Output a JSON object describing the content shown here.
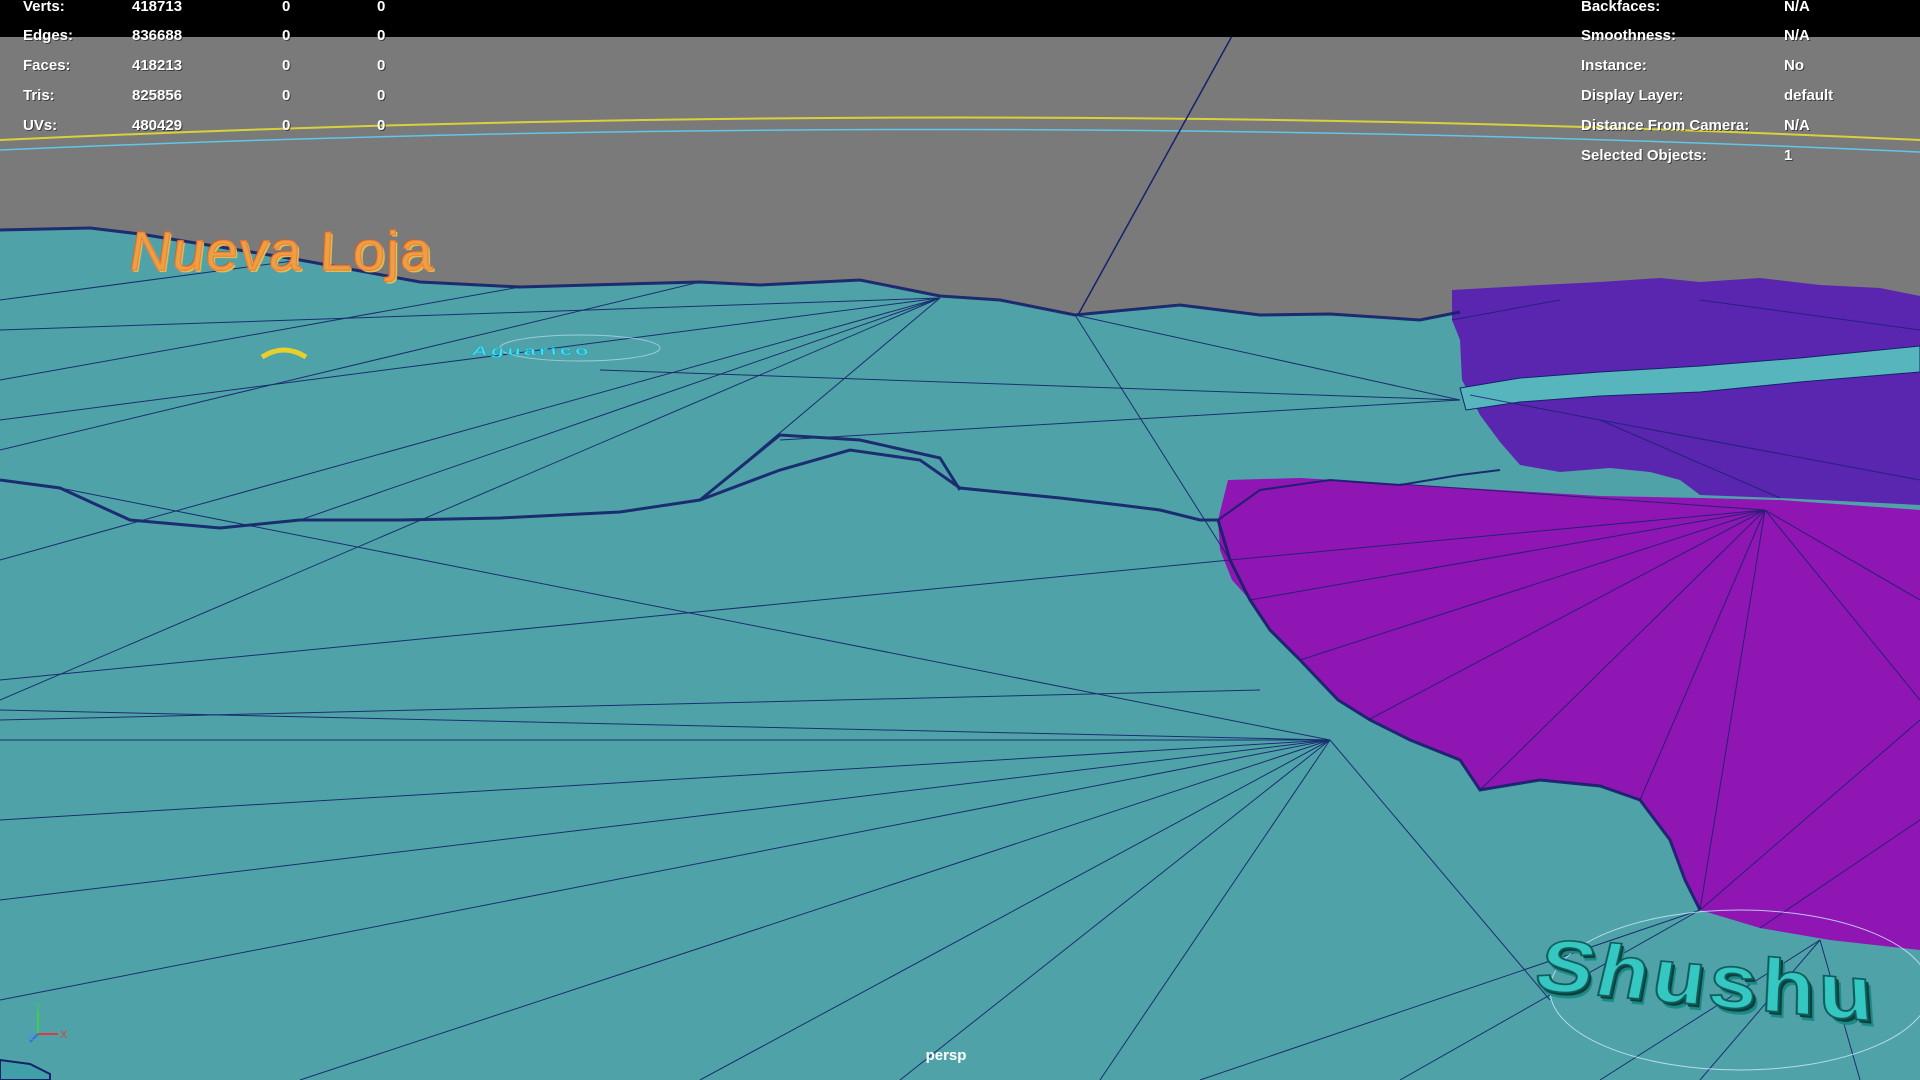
{
  "viewport": {
    "camera": "persp"
  },
  "hud_left": {
    "rows": [
      {
        "label": "Verts:",
        "total": "418713",
        "selected": "0",
        "extra": "0"
      },
      {
        "label": "Edges:",
        "total": "836688",
        "selected": "0",
        "extra": "0"
      },
      {
        "label": "Faces:",
        "total": "418213",
        "selected": "0",
        "extra": "0"
      },
      {
        "label": "Tris:",
        "total": "825856",
        "selected": "0",
        "extra": "0"
      },
      {
        "label": "UVs:",
        "total": "480429",
        "selected": "0",
        "extra": "0"
      }
    ]
  },
  "hud_right": {
    "rows": [
      {
        "label": "Backfaces:",
        "value": "N/A"
      },
      {
        "label": "Smoothness:",
        "value": "N/A"
      },
      {
        "label": "Instance:",
        "value": "No"
      },
      {
        "label": "Display Layer:",
        "value": "default"
      },
      {
        "label": "Distance From Camera:",
        "value": "N/A"
      },
      {
        "label": "Selected Objects:",
        "value": "1"
      }
    ]
  },
  "scene": {
    "city_labels": {
      "nueva_loja": "Nueva Loja",
      "shushufindi": "Shushu",
      "small_label": "Aguarico"
    },
    "colors": {
      "background": "#7a7a7a",
      "terrain_teal": "#4fa3a8",
      "wire": "#16216b",
      "region_purple": "#8f16b3",
      "region_violet": "#5a26b0",
      "horizon_yellow": "#d8d23a",
      "horizon_cyan": "#5fc7e8"
    }
  },
  "gizmo": {
    "y": "Y",
    "x": "X",
    "z": "Z"
  }
}
